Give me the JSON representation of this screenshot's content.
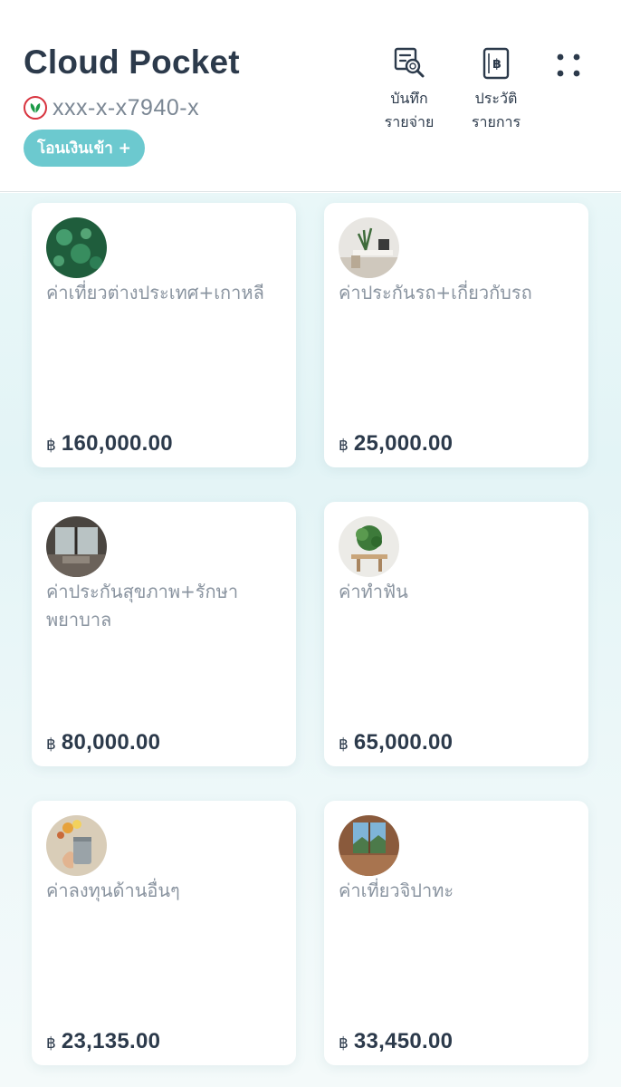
{
  "header": {
    "title": "Cloud Pocket",
    "account_number": "xxx-x-x7940-x",
    "transfer_label": "โอนเงินเข้า +",
    "actions": [
      {
        "label": "บันทึก\nรายจ่าย",
        "icon": "expense-record-icon"
      },
      {
        "label": "ประวัติ\nรายการ",
        "icon": "baht-history-icon"
      }
    ],
    "menu_icon": "dots-grid-icon"
  },
  "colors": {
    "accent": "#6cc9cf",
    "text_primary": "#2c3a4b",
    "text_secondary": "#8a94a0",
    "bank_red": "#d8343f",
    "bank_green": "#1a9a46"
  },
  "pockets": [
    {
      "name": "ค่าเที่ยวต่างประเทศ+เกาหลี",
      "currency": "฿",
      "amount": "160,000.00",
      "image": "jellyfish"
    },
    {
      "name": "ค่าประกันรถ+เกี่ยวกับรถ",
      "currency": "฿",
      "amount": "25,000.00",
      "image": "desk-plant"
    },
    {
      "name": "ค่าประกันสุขภาพ+รักษาพยาบาล",
      "currency": "฿",
      "amount": "80,000.00",
      "image": "window-room"
    },
    {
      "name": "ค่าทำฟัน",
      "currency": "฿",
      "amount": "65,000.00",
      "image": "table-plant"
    },
    {
      "name": "ค่าลงทุนด้านอื่นๆ",
      "currency": "฿",
      "amount": "23,135.00",
      "image": "coffee-flowers"
    },
    {
      "name": "ค่าเที่ยวจิปาทะ",
      "currency": "฿",
      "amount": "33,450.00",
      "image": "mountain-window"
    }
  ]
}
